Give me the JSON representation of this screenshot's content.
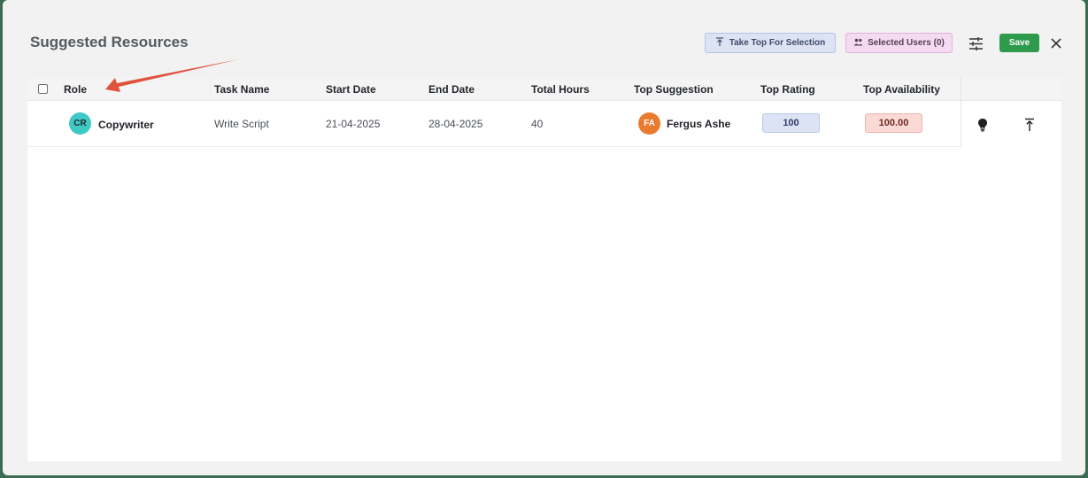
{
  "modal": {
    "title": "Suggested Resources",
    "take_top_label": "Take Top For Selection",
    "selected_users_label": "Selected Users (0)",
    "save_label": "Save"
  },
  "table": {
    "columns": [
      "Role",
      "Task Name",
      "Start Date",
      "End Date",
      "Total Hours",
      "Top Suggestion",
      "Top Rating",
      "Top Availability"
    ],
    "rows": [
      {
        "role_initials": "CR",
        "role": "Copywriter",
        "task_name": "Write Script",
        "start_date": "21-04-2025",
        "end_date": "28-04-2025",
        "total_hours": "40",
        "suggestion_initials": "FA",
        "top_suggestion": "Fergus Ashe",
        "top_rating": "100",
        "top_availability": "100.00"
      }
    ]
  },
  "colors": {
    "save": "#2e9a4b",
    "role_avatar": "#3fc9c4",
    "suggestion_avatar": "#ea7a2e",
    "rating_badge": "#dce3f5",
    "availability_badge": "#fbdad6",
    "annotation_arrow": "#e0523c"
  },
  "icons": [
    "take-top-icon",
    "users-icon",
    "filter-sliders-icon",
    "close-icon",
    "lightbulb-icon",
    "move-to-top-icon"
  ]
}
